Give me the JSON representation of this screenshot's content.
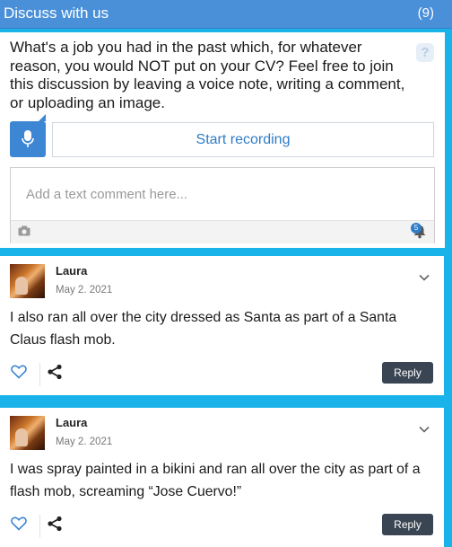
{
  "header": {
    "title": "Discuss with us",
    "count": "(9)"
  },
  "compose": {
    "prompt": "What's a job you had in the past which, for whatever reason, you would NOT put on your CV? Feel free to join this discussion by leaving a voice note, writing a comment, or uploading an image.",
    "help": "?",
    "record_label": "Start recording",
    "comment_placeholder": "Add a text comment here...",
    "notification_count": "5"
  },
  "comments": [
    {
      "author": "Laura",
      "date": "May 2. 2021",
      "text": "I also ran all over the city dressed as Santa as part of a Santa Claus flash mob.",
      "reply_label": "Reply"
    },
    {
      "author": "Laura",
      "date": "May 2. 2021",
      "text": "I was spray painted in a bikini and ran all over the city as part of a flash mob, screaming “Jose Cuervo!”",
      "reply_label": "Reply"
    }
  ],
  "colors": {
    "background": "#19b3ea",
    "header": "#4a90d9",
    "accent": "#3d86d3",
    "reply_button": "#3a4553"
  },
  "icons": {
    "help": "question-icon",
    "mic": "microphone-icon",
    "camera": "camera-icon",
    "bell": "bell-icon",
    "chevron": "chevron-down-icon",
    "like": "heart-icon",
    "share": "share-icon"
  }
}
